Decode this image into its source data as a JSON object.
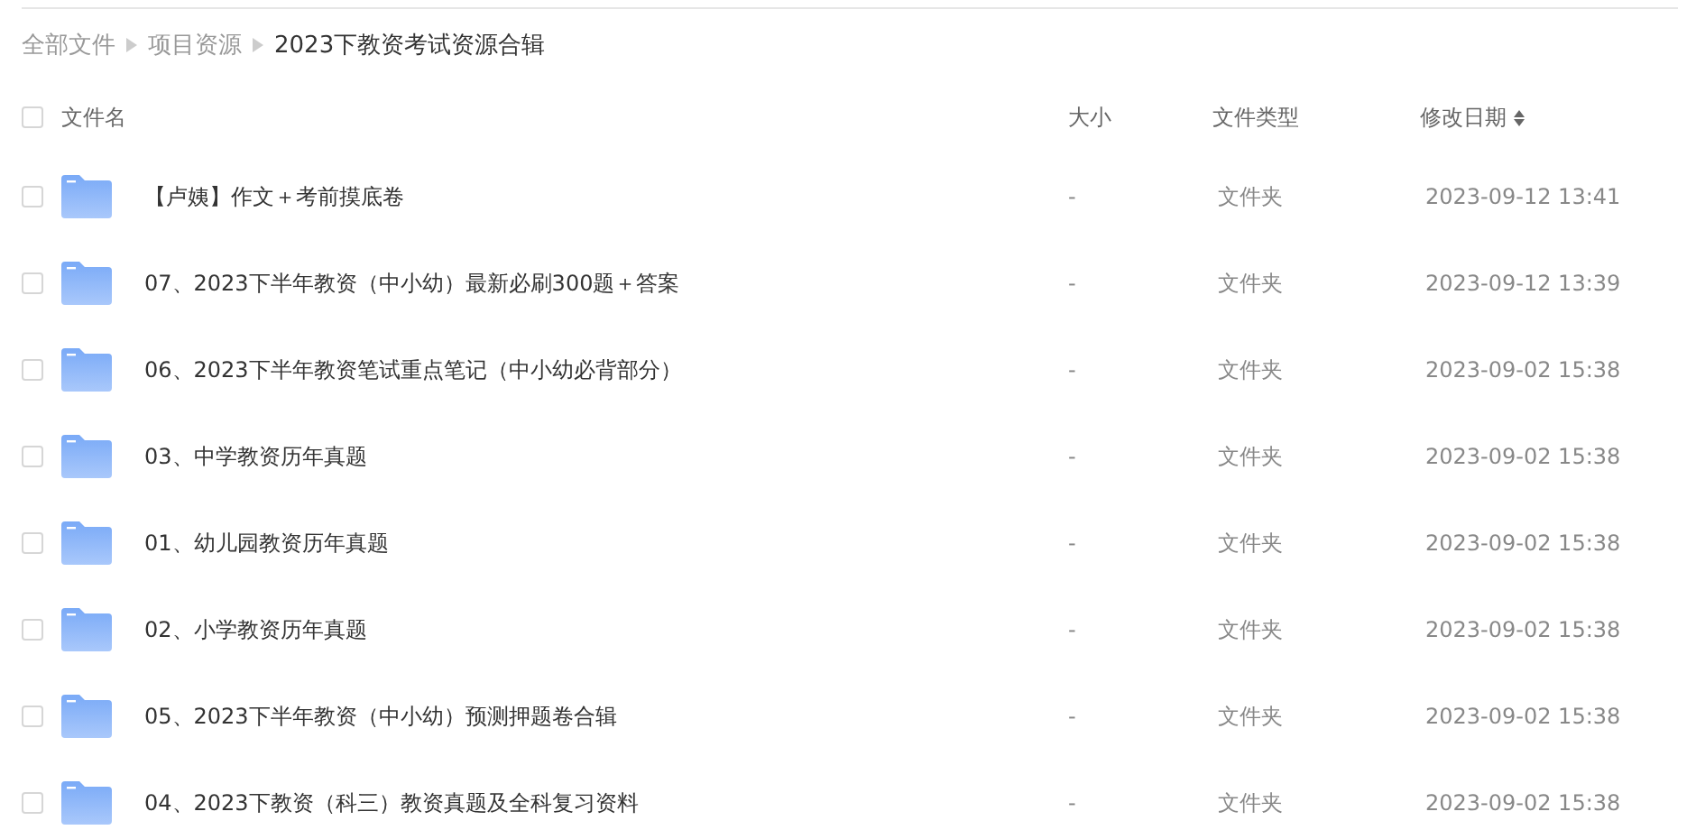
{
  "breadcrumb": [
    {
      "label": "全部文件",
      "current": false
    },
    {
      "label": "项目资源",
      "current": false
    },
    {
      "label": "2023下教资考试资源合辑",
      "current": true
    }
  ],
  "table": {
    "select_all": {
      "checked": false
    },
    "columns": [
      "文件名",
      "大小",
      "文件类型",
      "修改日期"
    ],
    "rows": [
      {
        "name": "【卢姨】作文＋考前摸底卷",
        "size": "-",
        "type": "文件夹",
        "modified": "2023-09-12 13:41",
        "checked": false
      },
      {
        "name": "07、2023下半年教资（中小幼）最新必刷300题＋答案",
        "size": "-",
        "type": "文件夹",
        "modified": "2023-09-12 13:39",
        "checked": false
      },
      {
        "name": "06、2023下半年教资笔试重点笔记（中小幼必背部分）",
        "size": "-",
        "type": "文件夹",
        "modified": "2023-09-02 15:38",
        "checked": false
      },
      {
        "name": "03、中学教资历年真题",
        "size": "-",
        "type": "文件夹",
        "modified": "2023-09-02 15:38",
        "checked": false
      },
      {
        "name": "01、幼儿园教资历年真题",
        "size": "-",
        "type": "文件夹",
        "modified": "2023-09-02 15:38",
        "checked": false
      },
      {
        "name": "02、小学教资历年真题",
        "size": "-",
        "type": "文件夹",
        "modified": "2023-09-02 15:38",
        "checked": false
      },
      {
        "name": "05、2023下半年教资（中小幼）预测押题卷合辑",
        "size": "-",
        "type": "文件夹",
        "modified": "2023-09-02 15:38",
        "checked": false
      },
      {
        "name": "04、2023下教资（科三）教资真题及全科复习资料",
        "size": "-",
        "type": "文件夹",
        "modified": "2023-09-02 15:38",
        "checked": false
      }
    ]
  }
}
